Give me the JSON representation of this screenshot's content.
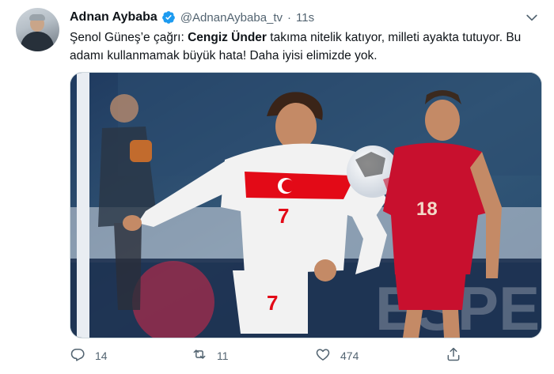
{
  "tweet": {
    "author_name": "Adnan Aybaba",
    "handle": "@AdnanAybaba_tv",
    "separator": "·",
    "time": "11s",
    "text_part1": "Şenol Güneş’e çağrı: ",
    "text_bold": "Cengiz Ünder",
    "text_part2": " takıma nitelik katıyor, milleti ayakta tutuyor. Bu adamı kullanmamak büyük hata! Daha iyisi elimizde yok.",
    "photo": {
      "jersey_number_main": "7",
      "shorts_number": "7",
      "jersey_number_opponent": "18"
    },
    "actions": {
      "reply_count": "14",
      "retweet_count": "11",
      "like_count": "474"
    }
  },
  "colors": {
    "verified": "#1d9bf0",
    "secondary_text": "#536471",
    "turkey_red": "#e30a17",
    "russia_red": "#c8102e"
  },
  "icons": [
    "verified-icon",
    "caret-down-icon",
    "reply-icon",
    "retweet-icon",
    "like-icon",
    "share-icon"
  ]
}
